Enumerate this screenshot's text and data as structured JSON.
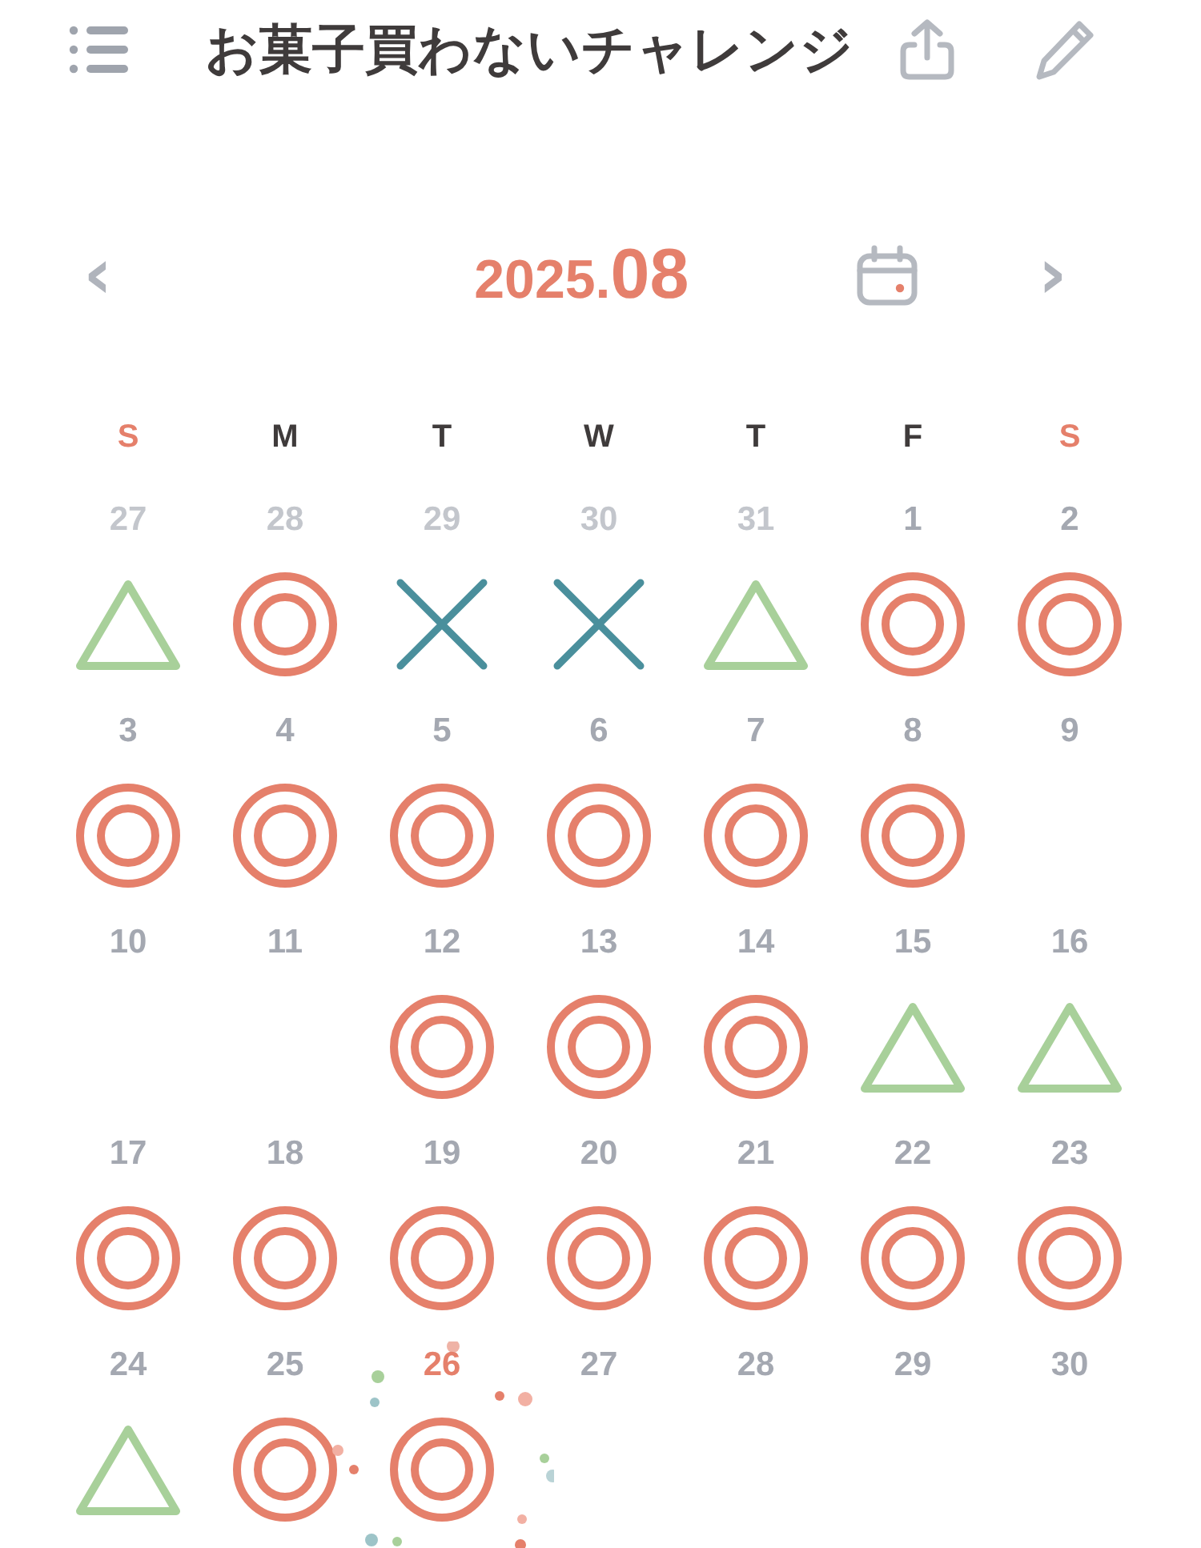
{
  "header": {
    "title": "お菓子買わないチャレンジ"
  },
  "month": {
    "year": "2025.",
    "month": "08",
    "prev": "‹",
    "next": "›"
  },
  "weekdays": [
    {
      "label": "S",
      "weekend": true
    },
    {
      "label": "M",
      "weekend": false
    },
    {
      "label": "T",
      "weekend": false
    },
    {
      "label": "W",
      "weekend": false
    },
    {
      "label": "T",
      "weekend": false
    },
    {
      "label": "F",
      "weekend": false
    },
    {
      "label": "S",
      "weekend": true
    }
  ],
  "weeks": [
    [
      {
        "day": "27",
        "outside": true,
        "today": false,
        "kind": "triangle"
      },
      {
        "day": "28",
        "outside": true,
        "today": false,
        "kind": "double_circle"
      },
      {
        "day": "29",
        "outside": true,
        "today": false,
        "kind": "cross"
      },
      {
        "day": "30",
        "outside": true,
        "today": false,
        "kind": "cross"
      },
      {
        "day": "31",
        "outside": true,
        "today": false,
        "kind": "triangle"
      },
      {
        "day": "1",
        "outside": false,
        "today": false,
        "kind": "double_circle"
      },
      {
        "day": "2",
        "outside": false,
        "today": false,
        "kind": "double_circle"
      }
    ],
    [
      {
        "day": "3",
        "outside": false,
        "today": false,
        "kind": "double_circle"
      },
      {
        "day": "4",
        "outside": false,
        "today": false,
        "kind": "double_circle"
      },
      {
        "day": "5",
        "outside": false,
        "today": false,
        "kind": "double_circle"
      },
      {
        "day": "6",
        "outside": false,
        "today": false,
        "kind": "double_circle"
      },
      {
        "day": "7",
        "outside": false,
        "today": false,
        "kind": "double_circle"
      },
      {
        "day": "8",
        "outside": false,
        "today": false,
        "kind": "double_circle"
      },
      {
        "day": "9",
        "outside": false,
        "today": false,
        "kind": "none"
      }
    ],
    [
      {
        "day": "10",
        "outside": false,
        "today": false,
        "kind": "none"
      },
      {
        "day": "11",
        "outside": false,
        "today": false,
        "kind": "none"
      },
      {
        "day": "12",
        "outside": false,
        "today": false,
        "kind": "double_circle"
      },
      {
        "day": "13",
        "outside": false,
        "today": false,
        "kind": "double_circle"
      },
      {
        "day": "14",
        "outside": false,
        "today": false,
        "kind": "double_circle"
      },
      {
        "day": "15",
        "outside": false,
        "today": false,
        "kind": "triangle"
      },
      {
        "day": "16",
        "outside": false,
        "today": false,
        "kind": "triangle"
      }
    ],
    [
      {
        "day": "17",
        "outside": false,
        "today": false,
        "kind": "double_circle"
      },
      {
        "day": "18",
        "outside": false,
        "today": false,
        "kind": "double_circle"
      },
      {
        "day": "19",
        "outside": false,
        "today": false,
        "kind": "double_circle"
      },
      {
        "day": "20",
        "outside": false,
        "today": false,
        "kind": "double_circle"
      },
      {
        "day": "21",
        "outside": false,
        "today": false,
        "kind": "double_circle"
      },
      {
        "day": "22",
        "outside": false,
        "today": false,
        "kind": "double_circle"
      },
      {
        "day": "23",
        "outside": false,
        "today": false,
        "kind": "double_circle"
      }
    ],
    [
      {
        "day": "24",
        "outside": false,
        "today": false,
        "kind": "triangle"
      },
      {
        "day": "25",
        "outside": false,
        "today": false,
        "kind": "double_circle"
      },
      {
        "day": "26",
        "outside": false,
        "today": true,
        "kind": "double_circle"
      },
      {
        "day": "27",
        "outside": false,
        "today": false,
        "kind": "none"
      },
      {
        "day": "28",
        "outside": false,
        "today": false,
        "kind": "none"
      },
      {
        "day": "29",
        "outside": false,
        "today": false,
        "kind": "none"
      },
      {
        "day": "30",
        "outside": false,
        "today": false,
        "kind": "none"
      }
    ]
  ]
}
